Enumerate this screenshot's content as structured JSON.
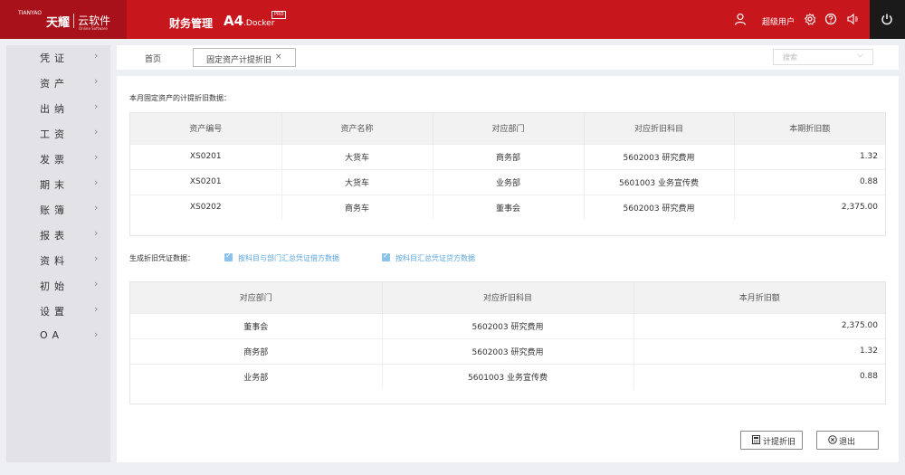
{
  "header": {
    "brand_en": "TIANYAO",
    "brand_cn": "天耀",
    "product": "云软件",
    "product_sub": "Online Software",
    "module_title": "财务管理",
    "a4": "A4",
    "docker": ".Docker",
    "pro": "PRO",
    "user_name": "超级用户",
    "icons": [
      "user-icon",
      "gear-icon",
      "help-icon",
      "notification-icon",
      "power-icon"
    ]
  },
  "sidebar": {
    "items": [
      {
        "label": "凭证"
      },
      {
        "label": "资产"
      },
      {
        "label": "出纳"
      },
      {
        "label": "工资"
      },
      {
        "label": "发票"
      },
      {
        "label": "期末"
      },
      {
        "label": "账簿"
      },
      {
        "label": "报表"
      },
      {
        "label": "资料"
      },
      {
        "label": "初始"
      },
      {
        "label": "设置"
      },
      {
        "label": "OA"
      }
    ]
  },
  "tabs": {
    "home": "首页",
    "active": "固定资产计提折旧",
    "close": "×",
    "search_placeholder": "搜索"
  },
  "section1": {
    "title": "本月固定资产的计提折旧数据：",
    "columns": [
      "资产编号",
      "资产名称",
      "对应部门",
      "对应折旧科目",
      "本期折旧额"
    ],
    "rows": [
      [
        "XS0201",
        "大货车",
        "商务部",
        "5602003 研究费用",
        "1.32"
      ],
      [
        "XS0201",
        "大货车",
        "业务部",
        "5601003 业务宣传费",
        "0.88"
      ],
      [
        "XS0202",
        "商务车",
        "董事会",
        "5602003 研究费用",
        "2,375.00"
      ]
    ]
  },
  "section2": {
    "title": "生成折旧凭证数据：",
    "checkbox1": "按科目与部门汇总凭证借方数据",
    "checkbox2": "按科目汇总凭证贷方数据",
    "columns": [
      "对应部门",
      "对应折旧科目",
      "本月折旧额"
    ],
    "rows": [
      [
        "董事会",
        "5602003 研究费用",
        "2,375.00"
      ],
      [
        "商务部",
        "5602003 研究费用",
        "1.32"
      ],
      [
        "业务部",
        "5601003 业务宣传费",
        "0.88"
      ]
    ]
  },
  "actions": {
    "depreciate": "计提折旧",
    "exit": "退出"
  }
}
